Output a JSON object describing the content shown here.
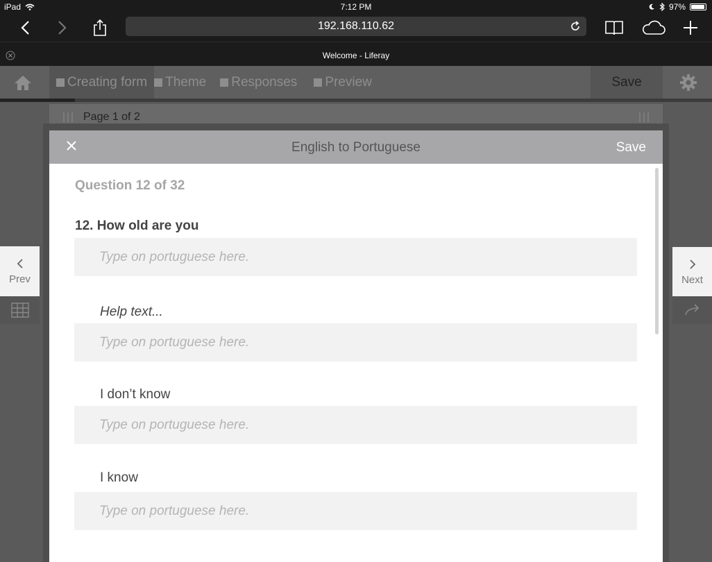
{
  "status_bar": {
    "device": "iPad",
    "time": "7:12 PM",
    "battery": "97%",
    "battery_level": 0.97
  },
  "safari": {
    "url": "192.168.110.62"
  },
  "browser_tab": {
    "title": "Welcome - Liferay"
  },
  "liferay_toolbar": {
    "tabs": [
      {
        "label": "Creating form"
      },
      {
        "label": "Theme"
      },
      {
        "label": "Responses"
      },
      {
        "label": "Preview"
      }
    ],
    "save_label": "Save"
  },
  "page_indicator": {
    "label": "Page 1 of 2"
  },
  "side_nav": {
    "prev_label": "Prev",
    "next_label": "Next"
  },
  "modal": {
    "title": "English to Portuguese",
    "save_label": "Save",
    "question_counter": "Question 12 of 32",
    "question_title": "12. How old are you",
    "fields": [
      {
        "label": "",
        "placeholder": "Type on portuguese here."
      },
      {
        "label": "Help text...",
        "placeholder": "Type on portuguese here."
      },
      {
        "label": "I don’t know",
        "placeholder": "Type on portuguese here."
      },
      {
        "label": "I know",
        "placeholder": "Type on portuguese here."
      }
    ]
  }
}
